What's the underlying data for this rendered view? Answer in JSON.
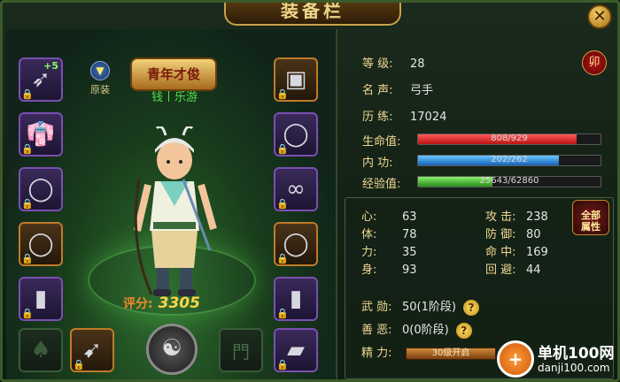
{
  "window": {
    "title": "装备栏",
    "close_glyph": "✕"
  },
  "left": {
    "original_outfit_label": "原装",
    "title_plaque": "青年才俊",
    "player_name": "钱丨乐游",
    "score_label": "评分:",
    "score_value": "3305",
    "slots_left": [
      {
        "icon": "bow-icon",
        "glyph": "➶",
        "plus": "+5",
        "locked": true
      },
      {
        "icon": "robe-icon",
        "glyph": "👘",
        "locked": true
      },
      {
        "icon": "necklace-icon",
        "glyph": "◯",
        "locked": true
      },
      {
        "icon": "ring-icon",
        "glyph": "◯",
        "locked": true
      },
      {
        "icon": "bracer-icon",
        "glyph": "▮",
        "locked": true
      }
    ],
    "slots_right": [
      {
        "icon": "armor-icon",
        "glyph": "▣",
        "locked": true
      },
      {
        "icon": "amulet-icon",
        "glyph": "◯",
        "locked": true
      },
      {
        "icon": "earring-icon",
        "glyph": "∞",
        "locked": true
      },
      {
        "icon": "ring-icon",
        "glyph": "◯",
        "locked": true
      },
      {
        "icon": "bracer-icon",
        "glyph": "▮",
        "locked": true
      }
    ],
    "bottom_slots": [
      {
        "icon": "cloak-icon",
        "glyph": "♠"
      },
      {
        "icon": "arrow-icon",
        "glyph": "➹"
      },
      {
        "icon": "gate-icon",
        "glyph": "門"
      },
      {
        "icon": "boots-icon",
        "glyph": "▰"
      }
    ]
  },
  "stats": {
    "level_label": "等 级:",
    "level": "28",
    "fame_label": "名 声:",
    "fame": "弓手",
    "exp_label": "历 练:",
    "exp": "17024",
    "seal": "卯",
    "hp_label": "生命值:",
    "hp_text": "808/929",
    "hp_pct": 0.87,
    "mp_label": "内 功:",
    "mp_text": "202/262",
    "mp_pct": 0.77,
    "xp_label": "经验值:",
    "xp_text": "25643/62860",
    "xp_pct": 0.41
  },
  "attributes": {
    "all_button": "全部\n属性",
    "items": [
      {
        "k": "心:",
        "v": "63"
      },
      {
        "k": "体:",
        "v": "78"
      },
      {
        "k": "力:",
        "v": "35"
      },
      {
        "k": "身:",
        "v": "93"
      },
      {
        "k": "攻 击:",
        "v": "238"
      },
      {
        "k": "防 御:",
        "v": "80"
      },
      {
        "k": "命 中:",
        "v": "169"
      },
      {
        "k": "回 避:",
        "v": "44"
      }
    ],
    "merit_label": "武 勋:",
    "merit": "50(1阶段)",
    "karma_label": "善 恶:",
    "karma": "0(0阶段)",
    "energy_label": "精 力:",
    "energy": "30级开启",
    "help_glyph": "?"
  },
  "watermark": {
    "logo": "+",
    "text": "单机100网",
    "url": "danji100.com"
  }
}
